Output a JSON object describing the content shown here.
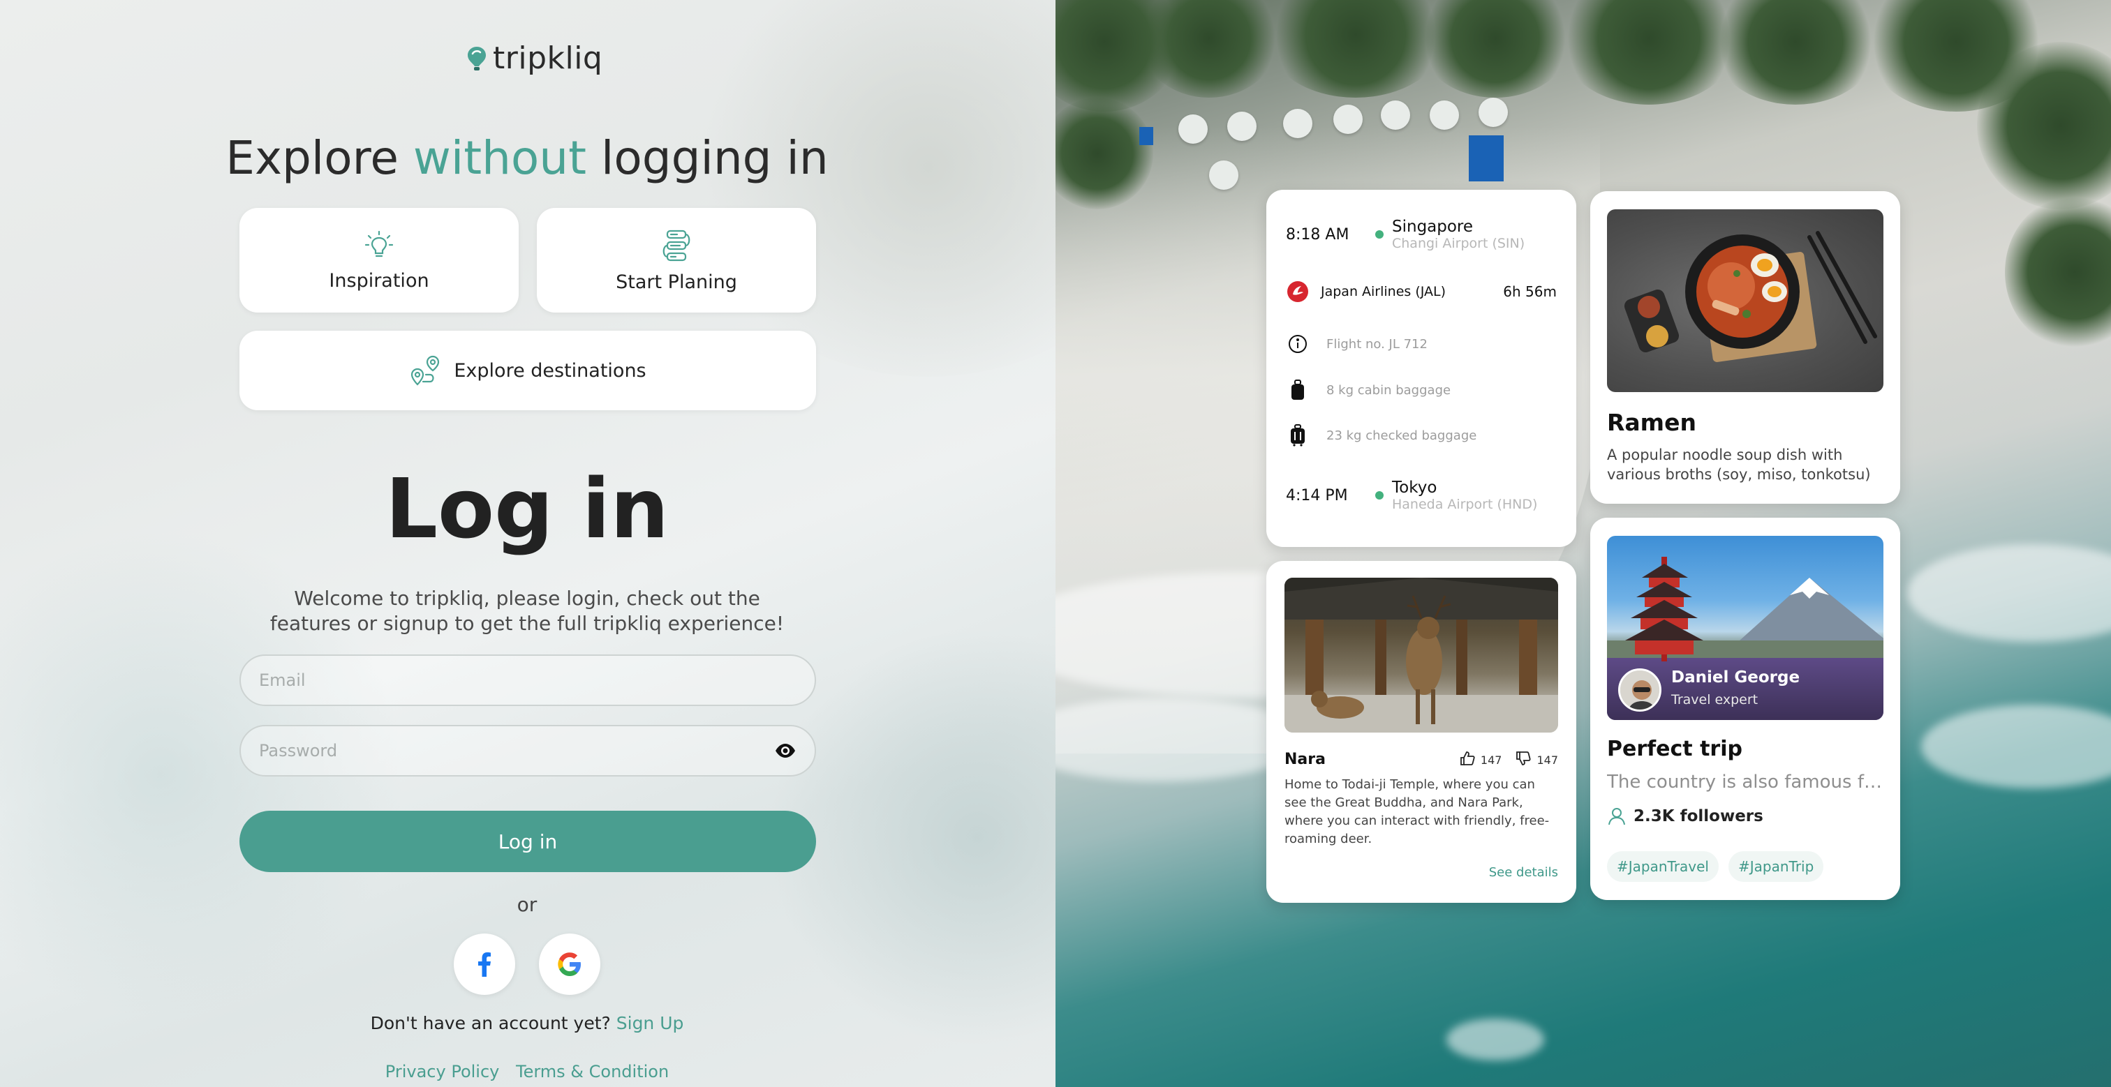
{
  "brand": {
    "name": "tripkliq",
    "accent": "#4aa394"
  },
  "headline": {
    "pre": "Explore ",
    "accent": "without",
    "post": " logging in"
  },
  "quick_actions": {
    "inspiration": "Inspiration",
    "start_planning": "Start Planing",
    "explore_destinations": "Explore destinations"
  },
  "login": {
    "title": "Log in",
    "welcome": "Welcome to tripkliq, please login, check out the features or signup to get the full tripkliq experience!",
    "email_placeholder": "Email",
    "password_placeholder": "Password",
    "submit": "Log in",
    "or": "or",
    "signup_prompt": "Don't have an account yet? ",
    "signup_link": "Sign Up",
    "privacy": "Privacy Policy",
    "terms": "Terms & Condition"
  },
  "flight": {
    "depart_time": "8:18 AM",
    "depart_city": "Singapore",
    "depart_airport": "Changi Airport (SIN)",
    "airline": "Japan Airlines (JAL)",
    "duration": "6h 56m",
    "flight_no": "Flight no. JL 712",
    "cabin": "8 kg cabin baggage",
    "checked": "23 kg checked baggage",
    "arrive_time": "4:14 PM",
    "arrive_city": "Tokyo",
    "arrive_airport": "Haneda Airport (HND)"
  },
  "ramen": {
    "title": "Ramen",
    "desc": "A popular noodle soup dish with various broths (soy, miso, tonkotsu)"
  },
  "nara": {
    "title": "Nara",
    "likes": "147",
    "dislikes": "147",
    "desc": "Home to Todai-ji Temple, where you can see the Great Buddha, and Nara Park, where you can interact with friendly, free-roaming deer.",
    "link": "See details"
  },
  "trip": {
    "author": "Daniel George",
    "role": "Travel expert",
    "title": "Perfect trip",
    "desc": "The country is also famous fo...",
    "followers": "2.3K followers",
    "tags": [
      "#JapanTravel",
      "#JapanTrip"
    ]
  }
}
